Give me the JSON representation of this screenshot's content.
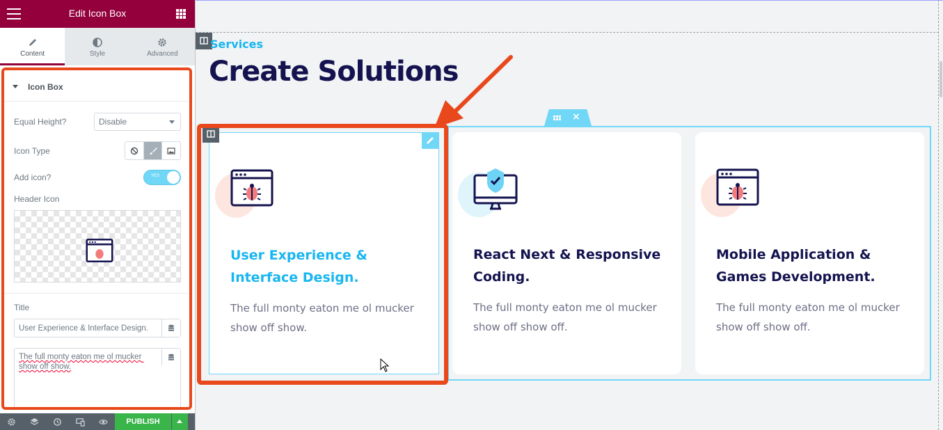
{
  "panel": {
    "header_title": "Edit Icon Box",
    "tabs": [
      {
        "label": "Content",
        "icon": "pencil-icon"
      },
      {
        "label": "Style",
        "icon": "half-circle-icon"
      },
      {
        "label": "Advanced",
        "icon": "gear-icon"
      }
    ],
    "section_label": "Icon Box",
    "equal_height_label": "Equal Height?",
    "equal_height_value": "Disable",
    "icon_type_label": "Icon Type",
    "add_icon_label": "Add icon?",
    "add_icon_toggle": "YES",
    "header_icon_label": "Header Icon",
    "title_label": "Title",
    "title_value": "User Experience & Interface Design.",
    "description_value": "The full monty eaton me ol mucker show off show.",
    "publish_label": "PUBLISH"
  },
  "canvas": {
    "subtitle": "Services",
    "title": "Create Solutions",
    "cards": [
      {
        "title": "User Experience & Interface Design.",
        "text": "The full monty eaton me ol mucker show off show.",
        "icon": "browser-bug-icon"
      },
      {
        "title": "React Next & Responsive Coding.",
        "text": "The full monty eaton me ol mucker show off show off.",
        "icon": "monitor-shield-icon"
      },
      {
        "title": "Mobile Application & Games Development.",
        "text": "The full monty eaton me ol mucker show off show off.",
        "icon": "browser-bug-icon"
      }
    ]
  },
  "colors": {
    "header": "#93003c",
    "accent": "#18b6f0",
    "highlight": "#e8481b",
    "title_dark": "#14134f",
    "publish": "#39b54a"
  }
}
